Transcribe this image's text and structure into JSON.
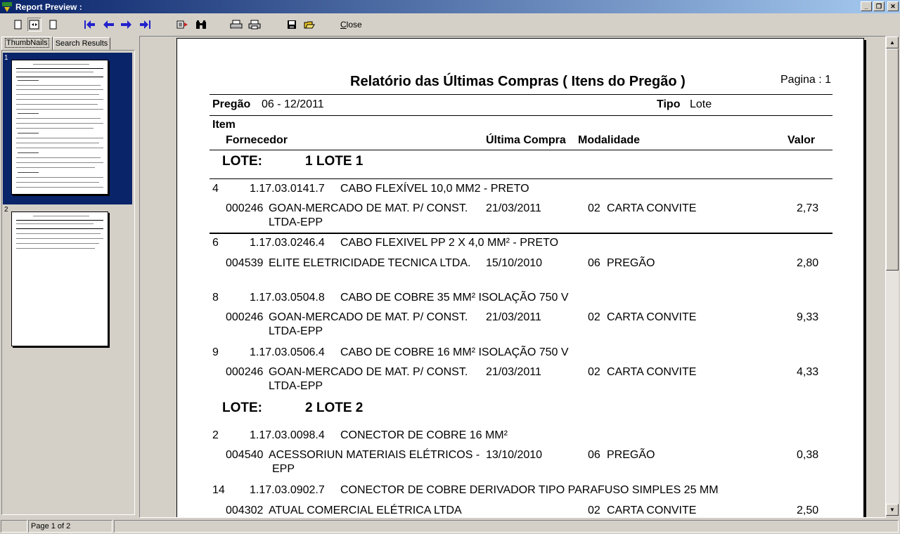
{
  "window": {
    "title": "Report Preview :"
  },
  "toolbar": {
    "close_label": "Close"
  },
  "tabs": {
    "thumbnails": "ThumbNails",
    "search_results": "Search Results"
  },
  "thumbnails": [
    {
      "number": "1"
    },
    {
      "number": "2"
    }
  ],
  "status": {
    "page_info": "Page 1 of 2"
  },
  "report": {
    "title": "Relatório das Últimas Compras ( Itens do Pregão )",
    "page_label": "Pagina :",
    "page_number": "1",
    "pregao_label": "Pregão",
    "pregao_value": "06 - 12/2011",
    "tipo_label": "Tipo",
    "tipo_value": "Lote",
    "headers": {
      "item": "Item",
      "fornecedor": "Fornecedor",
      "ultima_compra": "Última Compra",
      "modalidade": "Modalidade",
      "valor": "Valor"
    },
    "lote_label": "LOTE:",
    "lotes": [
      {
        "name": "1 LOTE 1"
      },
      {
        "name": "2 LOTE 2"
      }
    ],
    "items": [
      {
        "num": "4",
        "code": "1.17.03.0141.7",
        "desc": "CABO FLEXÍVEL 10,0 MM2 - PRETO",
        "forn_code": "000246",
        "forn_name": "GOAN-MERCADO DE MAT. P/ CONST.",
        "forn_name2": "LTDA-EPP",
        "date": "21/03/2011",
        "mod_code": "02",
        "mod_name": "CARTA CONVITE",
        "valor": "2,73"
      },
      {
        "num": "6",
        "code": "1.17.03.0246.4",
        "desc": "CABO FLEXIVEL PP 2 X 4,0 MM² - PRETO",
        "forn_code": "004539",
        "forn_name": "ELITE ELETRICIDADE TECNICA LTDA.",
        "forn_name2": "",
        "date": "15/10/2010",
        "mod_code": "06",
        "mod_name": "PREGÃO",
        "valor": "2,80"
      },
      {
        "num": "8",
        "code": "1.17.03.0504.8",
        "desc": "CABO DE COBRE 35 MM² ISOLAÇÃO 750 V",
        "forn_code": "000246",
        "forn_name": "GOAN-MERCADO DE MAT. P/ CONST.",
        "forn_name2": "LTDA-EPP",
        "date": "21/03/2011",
        "mod_code": "02",
        "mod_name": "CARTA CONVITE",
        "valor": "9,33"
      },
      {
        "num": "9",
        "code": "1.17.03.0506.4",
        "desc": "CABO DE COBRE 16 MM² ISOLAÇÃO 750 V",
        "forn_code": "000246",
        "forn_name": "GOAN-MERCADO DE MAT. P/ CONST.",
        "forn_name2": "LTDA-EPP",
        "date": "21/03/2011",
        "mod_code": "02",
        "mod_name": "CARTA CONVITE",
        "valor": "4,33"
      },
      {
        "num": "2",
        "code": "1.17.03.0098.4",
        "desc": "CONECTOR DE COBRE 16 MM²",
        "forn_code": "004540",
        "forn_name": "ACESSORIUN MATERIAIS ELÉTRICOS -",
        "forn_name2": "EPP",
        "date": "13/10/2010",
        "mod_code": "06",
        "mod_name": "PREGÃO",
        "valor": "0,38"
      },
      {
        "num": "14",
        "code": "1.17.03.0902.7",
        "desc": "CONECTOR DE COBRE DERIVADOR TIPO PARAFUSO SIMPLES 25 MM",
        "forn_code": "004302",
        "forn_name": "ATUAL COMERCIAL ELÉTRICA LTDA",
        "forn_name2": "",
        "date": "",
        "mod_code": "02",
        "mod_name": "CARTA CONVITE",
        "valor": "2,50"
      }
    ]
  }
}
